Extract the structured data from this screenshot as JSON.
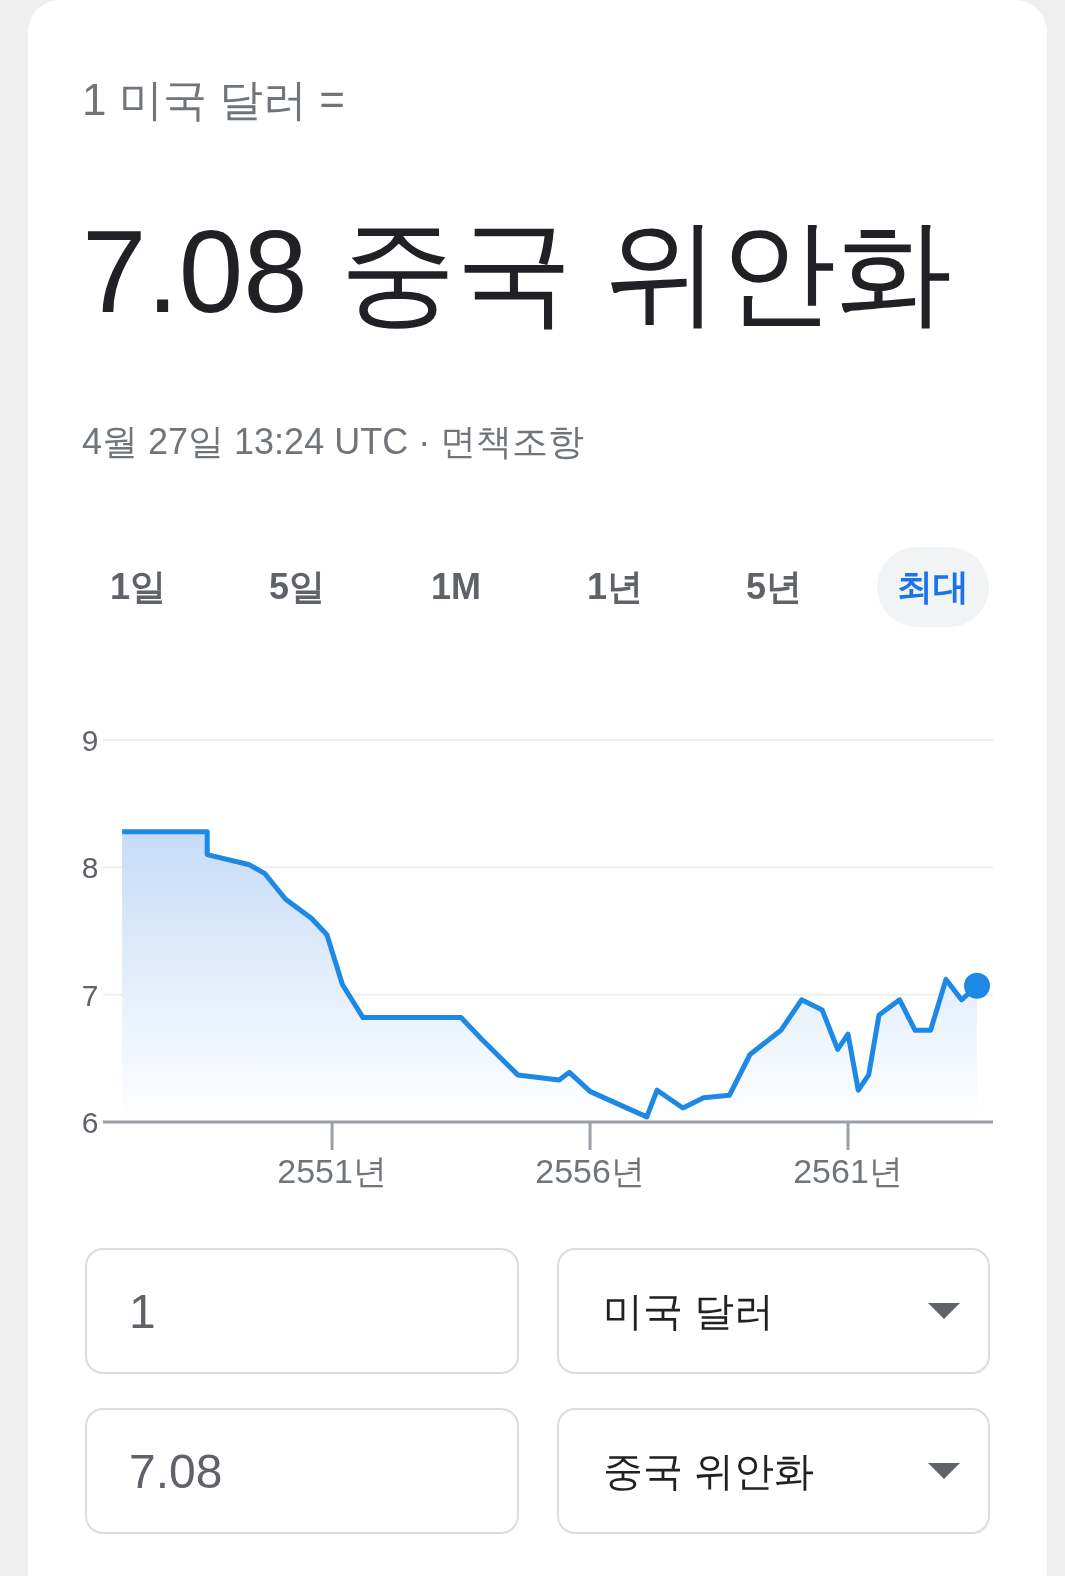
{
  "header": {
    "base": "1 미국 달러 =",
    "result": "7.08 중국 위안화",
    "timestamp": "4월 27일 13:24 UTC ·",
    "disclaimer": "면책조항"
  },
  "ranges": [
    {
      "label": "1일",
      "selected": false
    },
    {
      "label": "5일",
      "selected": false
    },
    {
      "label": "1M",
      "selected": false
    },
    {
      "label": "1년",
      "selected": false
    },
    {
      "label": "5년",
      "selected": false
    },
    {
      "label": "최대",
      "selected": true
    }
  ],
  "chart_data": {
    "type": "area",
    "xlim": [
      2546.56,
      2563.81
    ],
    "ylim": [
      6,
      9
    ],
    "yticks": [
      6,
      7,
      8,
      9
    ],
    "xticks": [
      {
        "value": 2551,
        "label": "2551년"
      },
      {
        "value": 2556,
        "label": "2556년"
      },
      {
        "value": 2561,
        "label": "2561년"
      }
    ],
    "x": [
      2546.93,
      2548.58,
      2548.58,
      2549.4,
      2549.7,
      2550.1,
      2550.6,
      2550.9,
      2551.2,
      2551.6,
      2552.3,
      2553.5,
      2553.9,
      2554.6,
      2555.4,
      2555.6,
      2556.0,
      2556.6,
      2557.1,
      2557.3,
      2557.8,
      2558.2,
      2558.7,
      2559.1,
      2559.7,
      2560.1,
      2560.5,
      2560.8,
      2561.0,
      2561.2,
      2561.4,
      2561.6,
      2562.0,
      2562.3,
      2562.6,
      2562.9,
      2563.2,
      2563.5
    ],
    "series": [
      {
        "color": "#1e88e5",
        "values": [
          8.28,
          8.28,
          8.1,
          8.02,
          7.95,
          7.75,
          7.6,
          7.47,
          7.08,
          6.82,
          6.82,
          6.82,
          6.65,
          6.37,
          6.33,
          6.39,
          6.24,
          6.13,
          6.04,
          6.25,
          6.11,
          6.19,
          6.21,
          6.53,
          6.72,
          6.96,
          6.88,
          6.57,
          6.69,
          6.25,
          6.37,
          6.84,
          6.96,
          6.72,
          6.72,
          7.12,
          6.96,
          7.07
        ]
      }
    ]
  },
  "converter": [
    {
      "amount": "1",
      "currency": "미국 달러"
    },
    {
      "amount": "7.08",
      "currency": "중국 위안화"
    }
  ]
}
